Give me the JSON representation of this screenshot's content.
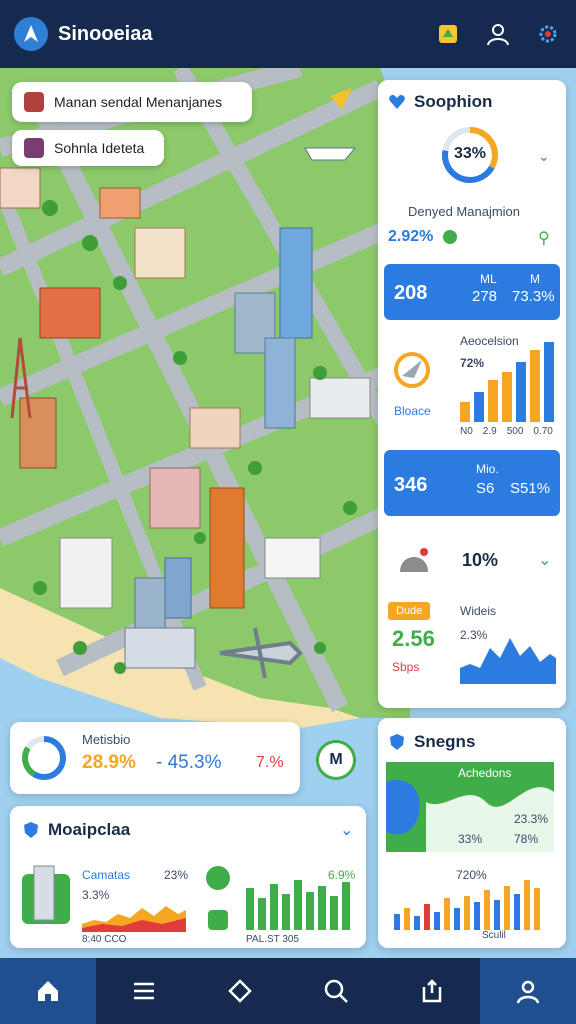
{
  "app": {
    "title": "Sinooeiaa"
  },
  "top_icons": [
    "notification-icon",
    "user-icon",
    "settings-icon"
  ],
  "chips": [
    {
      "label": "Manan sendal Menanjanes"
    },
    {
      "label": "Sohnla Ideteta"
    }
  ],
  "sidebar_card": {
    "title": "Soophion",
    "donut_value": "33%",
    "subtitle": "Denyed Manajmion",
    "stat_left": "2.92%",
    "stat1": {
      "a": "208",
      "b": "ML",
      "c": "278",
      "d": "M",
      "e": "73.3%"
    },
    "chart1": {
      "label": "Aeocelsion",
      "pct": "72%",
      "left": "Bloace",
      "axis": [
        "N0",
        "2.9",
        "500",
        "0.70"
      ]
    },
    "stat2": {
      "a": "346",
      "b": "Mio.",
      "c": "S6",
      "d": "S51%"
    },
    "pct_row": "10%",
    "chart2": {
      "badge": "Dude",
      "value": "2.56",
      "title": "Wideis",
      "pct": "2.3%",
      "sub": "Sbps"
    }
  },
  "mid_card": {
    "title": "Metisbio",
    "v1": "28.9%",
    "v2": "- 45.3%",
    "v3": "7.%",
    "badge": "M"
  },
  "bottom_left_card": {
    "title": "Moaipclaa",
    "label1": "Camatas",
    "v1": "23%",
    "v2": "3.3%",
    "footer1": "8:40 CCO",
    "v3": "6.9%",
    "footer2": "PAL.ST 305"
  },
  "bottom_right_card": {
    "title": "Snegns",
    "area_label": "Achedons",
    "v1": "23.3%",
    "v2": "33%",
    "v3": "78%",
    "bar_pct": "720%",
    "bar_footer": "Sculil"
  },
  "nav": [
    "home",
    "menu",
    "layers",
    "search",
    "share",
    "profile"
  ],
  "colors": {
    "navy": "#142b4f",
    "blue": "#2c7be0",
    "orange": "#f5a623",
    "green": "#3fae49"
  }
}
